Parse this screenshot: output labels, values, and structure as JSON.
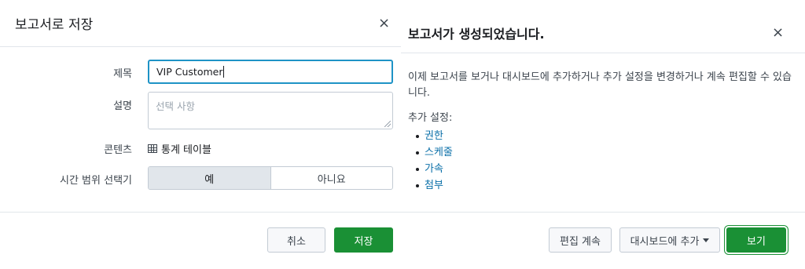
{
  "save_dialog": {
    "title": "보고서로 저장",
    "close_icon": "×",
    "fields": {
      "title_label": "제목",
      "title_value": "VIP Customer",
      "description_label": "설명",
      "description_placeholder": "선택 사항",
      "content_label": "콘텐츠",
      "content_icon": "table-icon",
      "content_value": "통계 테이블",
      "time_picker_label": "시간 범위 선택기",
      "time_picker_options": [
        "예",
        "아니요"
      ],
      "time_picker_selected": "예"
    },
    "buttons": {
      "cancel": "취소",
      "save": "저장"
    }
  },
  "created_dialog": {
    "title": "보고서가 생성되었습니다.",
    "close_icon": "×",
    "message": "이제 보고서를 보거나 대시보드에 추가하거나 추가 설정을 변경하거나 계속 편집할 수 있습니다.",
    "additional_settings_label": "추가 설정:",
    "links": [
      "권한",
      "스케줄",
      "가속",
      "첨부"
    ],
    "buttons": {
      "continue_editing": "편집 계속",
      "add_to_dashboard": "대시보드에 추가",
      "view": "보기"
    }
  },
  "colors": {
    "primary_green": "#1a9035",
    "focus_blue": "#1e93c6",
    "link_blue": "#0a6fa8"
  }
}
